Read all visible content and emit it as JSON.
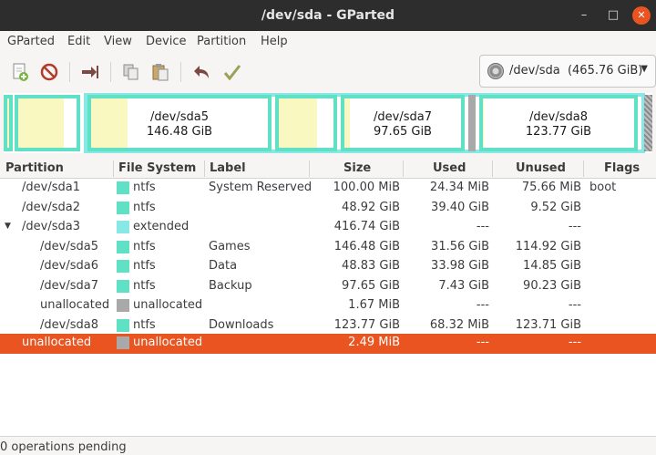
{
  "window": {
    "title": "/dev/sda - GParted",
    "minimize": "–",
    "maximize": "□",
    "close": "✕"
  },
  "menu": [
    "GParted",
    "Edit",
    "View",
    "Device",
    "Partition",
    "Help"
  ],
  "toolbar": {
    "icons": [
      "new-partition-icon",
      "delete-icon",
      "resize-move-icon",
      "copy-icon",
      "paste-icon",
      "undo-icon",
      "apply-icon"
    ]
  },
  "device": {
    "name": "/dev/sda",
    "size": "(465.76 GiB)"
  },
  "diskmap": {
    "sda5": {
      "name": "/dev/sda5",
      "size": "146.48 GiB"
    },
    "sda7": {
      "name": "/dev/sda7",
      "size": "97.65 GiB"
    },
    "sda8": {
      "name": "/dev/sda8",
      "size": "123.77 GiB"
    }
  },
  "columns": [
    "Partition",
    "File System",
    "Label",
    "Size",
    "Used",
    "Unused",
    "Flags"
  ],
  "colors": {
    "ntfs": "#60e0c4",
    "extended": "#87e8e6",
    "unallocated": "#a9a9a9",
    "selection": "#e95420",
    "used": "#f8f8c0"
  },
  "rows": [
    {
      "partition": "/dev/sda1",
      "fs": "ntfs",
      "label": "System Reserved",
      "size": "100.00 MiB",
      "used": "24.34 MiB",
      "unused": "75.66 MiB",
      "flags": "boot"
    },
    {
      "partition": "/dev/sda2",
      "fs": "ntfs",
      "label": "",
      "size": "48.92 GiB",
      "used": "39.40 GiB",
      "unused": "9.52 GiB",
      "flags": ""
    },
    {
      "partition": "/dev/sda3",
      "fs": "extended",
      "label": "",
      "size": "416.74 GiB",
      "used": "---",
      "unused": "---",
      "flags": ""
    },
    {
      "partition": "/dev/sda5",
      "fs": "ntfs",
      "label": "Games",
      "size": "146.48 GiB",
      "used": "31.56 GiB",
      "unused": "114.92 GiB",
      "flags": ""
    },
    {
      "partition": "/dev/sda6",
      "fs": "ntfs",
      "label": "Data",
      "size": "48.83 GiB",
      "used": "33.98 GiB",
      "unused": "14.85 GiB",
      "flags": ""
    },
    {
      "partition": "/dev/sda7",
      "fs": "ntfs",
      "label": "Backup",
      "size": "97.65 GiB",
      "used": "7.43 GiB",
      "unused": "90.23 GiB",
      "flags": ""
    },
    {
      "partition": "unallocated",
      "fs": "unallocated",
      "label": "",
      "size": "1.67 MiB",
      "used": "---",
      "unused": "---",
      "flags": ""
    },
    {
      "partition": "/dev/sda8",
      "fs": "ntfs",
      "label": "Downloads",
      "size": "123.77 GiB",
      "used": "68.32 MiB",
      "unused": "123.71 GiB",
      "flags": ""
    },
    {
      "partition": "unallocated",
      "fs": "unallocated",
      "label": "",
      "size": "2.49 MiB",
      "used": "---",
      "unused": "---",
      "flags": ""
    }
  ],
  "status": "0 operations pending"
}
